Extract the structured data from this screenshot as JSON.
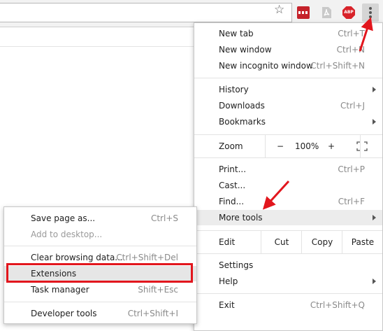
{
  "colors": {
    "accent_red": "#e2161d",
    "highlight": "#ececec"
  },
  "toolbar": {
    "star_icon": "star-icon",
    "extensions": [
      "ext-red-dots-icon",
      "pdf-icon",
      "abp-icon"
    ],
    "abp_label": "ABP",
    "menu_icon": "kebab-menu-icon"
  },
  "menu": {
    "new_tab": {
      "label": "New tab",
      "shortcut": "Ctrl+T"
    },
    "new_window": {
      "label": "New window",
      "shortcut": "Ctrl+N"
    },
    "incognito": {
      "label": "New incognito window",
      "shortcut": "Ctrl+Shift+N"
    },
    "history": {
      "label": "History"
    },
    "downloads": {
      "label": "Downloads",
      "shortcut": "Ctrl+J"
    },
    "bookmarks": {
      "label": "Bookmarks"
    },
    "zoom": {
      "label": "Zoom",
      "minus": "−",
      "value": "100%",
      "plus": "+",
      "fullscreen_icon": "fullscreen-icon"
    },
    "print": {
      "label": "Print...",
      "shortcut": "Ctrl+P"
    },
    "cast": {
      "label": "Cast..."
    },
    "find": {
      "label": "Find...",
      "shortcut": "Ctrl+F"
    },
    "more_tools": {
      "label": "More tools"
    },
    "edit": {
      "label": "Edit",
      "cut": "Cut",
      "copy": "Copy",
      "paste": "Paste"
    },
    "settings": {
      "label": "Settings"
    },
    "help": {
      "label": "Help"
    },
    "exit": {
      "label": "Exit",
      "shortcut": "Ctrl+Shift+Q"
    }
  },
  "submenu": {
    "save_page": {
      "label": "Save page as...",
      "shortcut": "Ctrl+S"
    },
    "add_desktop": {
      "label": "Add to desktop..."
    },
    "clear_data": {
      "label": "Clear browsing data...",
      "shortcut": "Ctrl+Shift+Del"
    },
    "extensions": {
      "label": "Extensions"
    },
    "task_manager": {
      "label": "Task manager",
      "shortcut": "Shift+Esc"
    },
    "dev_tools": {
      "label": "Developer tools",
      "shortcut": "Ctrl+Shift+I"
    }
  }
}
